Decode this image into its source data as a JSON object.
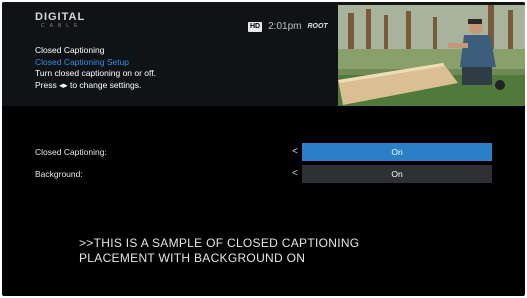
{
  "header": {
    "logo_line1": "DIGITAL",
    "logo_line2": "CABLE",
    "channel_badge": "HD",
    "time": "2:01pm",
    "network": "ROOT"
  },
  "info": {
    "title": "Closed Captioning",
    "subtitle": "Closed Captioning Setup",
    "description": "Turn closed captioning on or off.",
    "hint": "Press ◂▸ to change settings."
  },
  "settings": [
    {
      "label": "Closed Captioning:",
      "value": "On",
      "arrow": "<",
      "selected": true
    },
    {
      "label": "Background:",
      "value": "On",
      "arrow": "<",
      "selected": false
    }
  ],
  "caption": {
    "line1": ">>THIS IS A SAMPLE OF CLOSED CAPTIONING",
    "line2": "PLACEMENT WITH BACKGROUND ON"
  },
  "colors": {
    "accent": "#2a7fc7",
    "highlight_text": "#2f8fe6",
    "unselected_row": "#2e3034",
    "screen": "#000000"
  }
}
